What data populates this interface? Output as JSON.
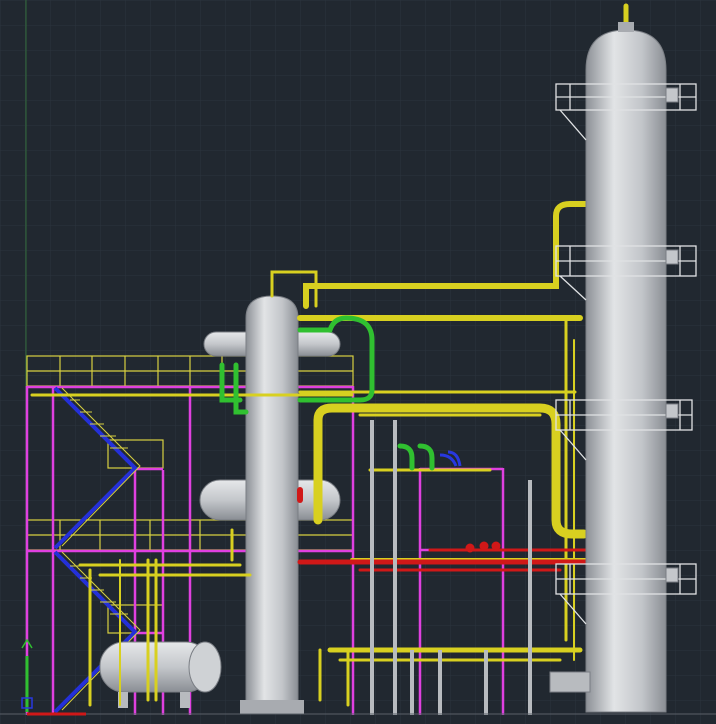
{
  "viewport": {
    "background": "#212830",
    "grid_color": "#2c343e",
    "ucs_icon": "ucs-axis-icon"
  },
  "model": {
    "equipment": [
      "tall-column",
      "short-column",
      "horizontal-drum",
      "structure-frame"
    ],
    "colors": {
      "vessel": "#c9ccd0",
      "vessel_shade": "#9a9ea4",
      "platform": "#c8c8c8",
      "structure": "#e040e0",
      "bracing": "#2430d8",
      "pipe_yellow": "#d8d020",
      "pipe_green": "#30c030",
      "pipe_red": "#d01818",
      "pipe_blue": "#2838e0",
      "handrail": "#d8d040"
    }
  }
}
